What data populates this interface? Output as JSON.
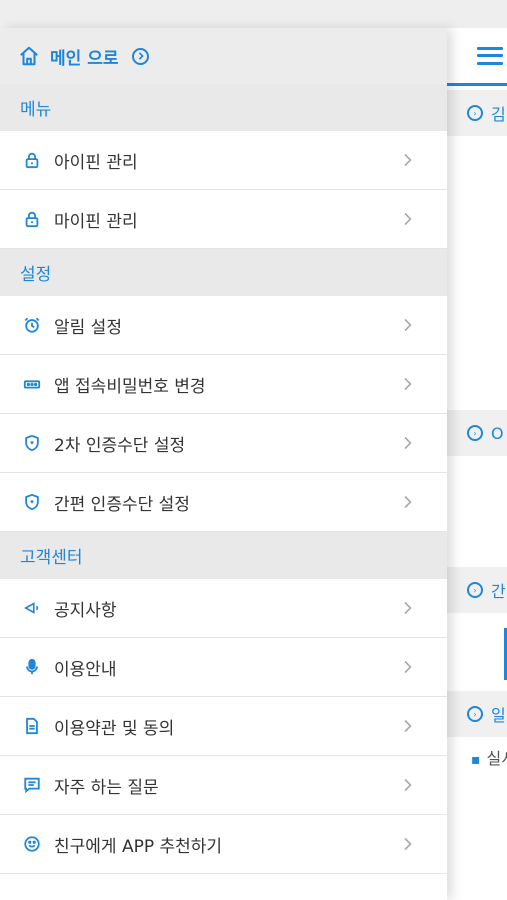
{
  "home": {
    "label": "메인 으로"
  },
  "sections": [
    {
      "title": "메뉴",
      "items": [
        {
          "label": "아이핀 관리",
          "icon": "lock-icon"
        },
        {
          "label": "마이핀 관리",
          "icon": "lock-icon"
        }
      ]
    },
    {
      "title": "설정",
      "items": [
        {
          "label": "알림 설정",
          "icon": "alarm-clock-icon"
        },
        {
          "label": "앱 접속비밀번호 변경",
          "icon": "password-icon"
        },
        {
          "label": "2차 인증수단 설정",
          "icon": "shield-icon"
        },
        {
          "label": "간편 인증수단 설정",
          "icon": "shield-icon"
        }
      ]
    },
    {
      "title": "고객센터",
      "items": [
        {
          "label": "공지사항",
          "icon": "megaphone-icon"
        },
        {
          "label": "이용안내",
          "icon": "microphone-icon"
        },
        {
          "label": "이용약관 및 동의",
          "icon": "document-icon"
        },
        {
          "label": "자주 하는 질문",
          "icon": "chat-icon"
        },
        {
          "label": "친구에게 APP 추천하기",
          "icon": "smile-icon"
        }
      ]
    }
  ],
  "background": {
    "section_labels": [
      "김",
      "O",
      "간",
      "일"
    ],
    "bullet_text": "실시"
  },
  "colors": {
    "accent": "#1f86d8",
    "text": "#333333",
    "section_bg": "#e9e9e9"
  }
}
